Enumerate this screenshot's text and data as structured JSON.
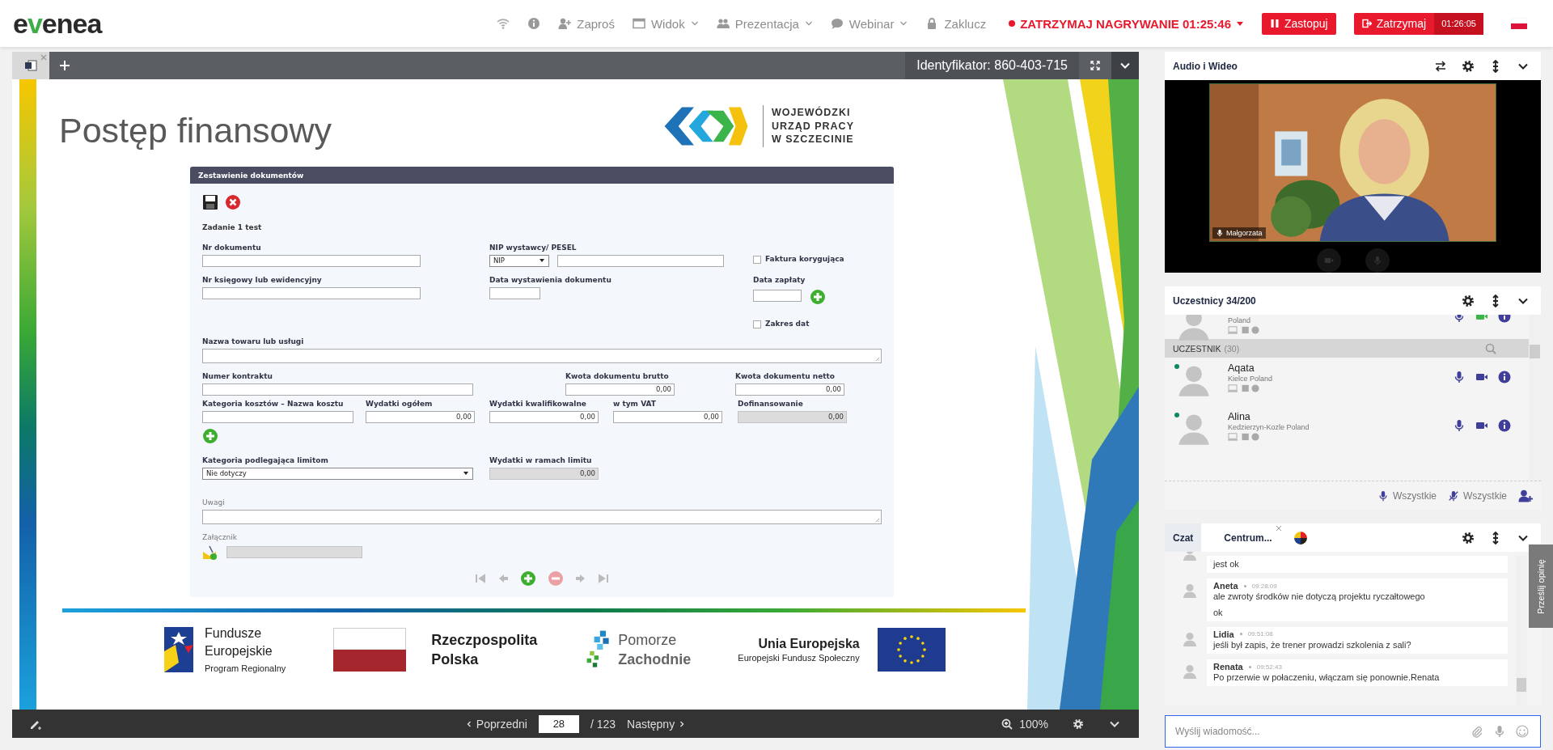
{
  "header": {
    "logo": [
      {
        "text": "e",
        "accent": false
      },
      {
        "text": "v",
        "accent": true
      },
      {
        "text": "enea",
        "accent": false
      }
    ],
    "nav": [
      {
        "label": "Zaproś",
        "dropdown": false
      },
      {
        "label": "Widok",
        "dropdown": true
      },
      {
        "label": "Prezentacja",
        "dropdown": true
      },
      {
        "label": "Webinar",
        "dropdown": true
      },
      {
        "label": "Zaklucz",
        "dropdown": false
      }
    ],
    "recording": "ZATRZYMAJ NAGRYWANIE 01:25:46",
    "pause_button": "Zastopuj",
    "stop_button": "Zatrzymaj",
    "stop_timer": "01:26:05"
  },
  "presentation": {
    "identifier": "Identyfikator: 860-403-715",
    "slide": {
      "title": "Postęp finansowy",
      "org_name": [
        "WOJEWÓDZKI",
        "URZĄD PRACY",
        "W SZCZECINIE"
      ],
      "form": {
        "title": "Zestawienie dokumentów",
        "task": "Zadanie 1 test",
        "rows": [
          {
            "fields": [
              {
                "kind": "text",
                "label": "Nr dokumentu"
              },
              {
                "kind": "nip",
                "label": "NIP wystawcy/ PESEL",
                "value": "NIP"
              },
              {
                "kind": "checkbox",
                "label": "Faktura korygująca",
                "checked": false
              }
            ]
          },
          {
            "fields": [
              {
                "kind": "text",
                "label": "Nr księgowy lub ewidencyjny"
              },
              {
                "kind": "text",
                "label": "Data wystawienia dokumentu"
              },
              {
                "kind": "date_add",
                "label": "Data zapłaty"
              }
            ]
          },
          {
            "fields": [
              {
                "kind": "checkbox",
                "label": "Zakres dat",
                "checked": false
              }
            ]
          },
          {
            "fields": [
              {
                "kind": "textarea",
                "label": "Nazwa towaru lub usługi"
              }
            ]
          },
          {
            "fields": [
              {
                "kind": "text",
                "label": "Numer kontraktu"
              },
              {
                "kind": "amount",
                "label": "Kwota dokumentu brutto",
                "value": "0,00",
                "disabled": false
              },
              {
                "kind": "amount",
                "label": "Kwota dokumentu netto",
                "value": "0,00",
                "disabled": false
              }
            ]
          },
          {
            "fields": [
              {
                "kind": "text",
                "label": "Kategoria kosztów – Nazwa kosztu"
              },
              {
                "kind": "amount",
                "label": "Wydatki ogółem",
                "value": "0,00",
                "disabled": false
              },
              {
                "kind": "amount",
                "label": "Wydatki kwalifikowalne",
                "value": "0,00",
                "disabled": false
              },
              {
                "kind": "amount",
                "label": "w tym VAT",
                "value": "0,00",
                "disabled": false
              },
              {
                "kind": "amount",
                "label": "Dofinansowanie",
                "value": "0,00",
                "disabled": true
              }
            ]
          },
          {
            "fields": [
              {
                "kind": "add"
              }
            ]
          },
          {
            "fields": [
              {
                "kind": "select",
                "label": "Kategoria podlegająca limitom",
                "value": "Nie dotyczy"
              },
              {
                "kind": "amount",
                "label": "Wydatki w ramach limitu",
                "value": "0,00",
                "disabled": true
              }
            ]
          },
          {
            "fields": [
              {
                "kind": "note",
                "label": "Uwagi"
              }
            ]
          },
          {
            "fields": [
              {
                "kind": "attachment",
                "label": "Załącznik"
              }
            ]
          }
        ]
      },
      "footer_logos": [
        {
          "kind": "fe",
          "lines": [
            "Fundusze",
            "Europejskie",
            "Program Regionalny"
          ]
        },
        {
          "kind": "rp",
          "lines": [
            "Rzeczpospolita",
            "Polska"
          ]
        },
        {
          "kind": "pz",
          "lines": [
            "Pomorze",
            "Zachodnie"
          ]
        },
        {
          "kind": "ue",
          "lines": [
            "Unia Europejska",
            "Europejski Fundusz Społeczny"
          ]
        }
      ]
    },
    "toolbar": {
      "prev": "Poprzedni",
      "page": "28",
      "total": "/ 123",
      "next": "Następny",
      "zoom": "100%"
    }
  },
  "audio_video": {
    "title": "Audio i Wideo",
    "speaker": "Małgorzata"
  },
  "participants": {
    "title": "Uczestnicy 34/200",
    "top_row": {
      "location": "Poland",
      "camera_on": true
    },
    "group": "UCZESTNIK",
    "group_count": "(30)",
    "rows": [
      {
        "name": "Aqata",
        "location": "Kielce Poland",
        "online": true,
        "camera_on": false
      },
      {
        "name": "Alina",
        "location": "Kedzierzyn-Kozle Poland",
        "online": true,
        "camera_on": false
      }
    ],
    "mute_all": "Wszystkie",
    "unmute_all": "Wszystkie"
  },
  "chat": {
    "tabs": [
      {
        "label": "Czat",
        "selected": true
      },
      {
        "label": "Centrum...",
        "selected": false
      }
    ],
    "messages": [
      {
        "lines": [
          "jest ok"
        ]
      },
      {
        "author": "Aneta",
        "time": "09:28:09",
        "lines": [
          "ale zwroty środków  nie  dotyczą projektu ryczałtowego",
          "ok"
        ]
      },
      {
        "author": "Lidia",
        "time": "09:51:08",
        "lines": [
          "jeśli był zapis, że trener prowadzi szkolenia z sali?"
        ]
      },
      {
        "author": "Renata",
        "time": "09:52:43",
        "lines": [
          "Po przerwie w połaczeniu, włączam się ponownie.Renata"
        ]
      }
    ],
    "placeholder": "Wyślij wiadomość..."
  },
  "feedback": "Prześlij opinię"
}
